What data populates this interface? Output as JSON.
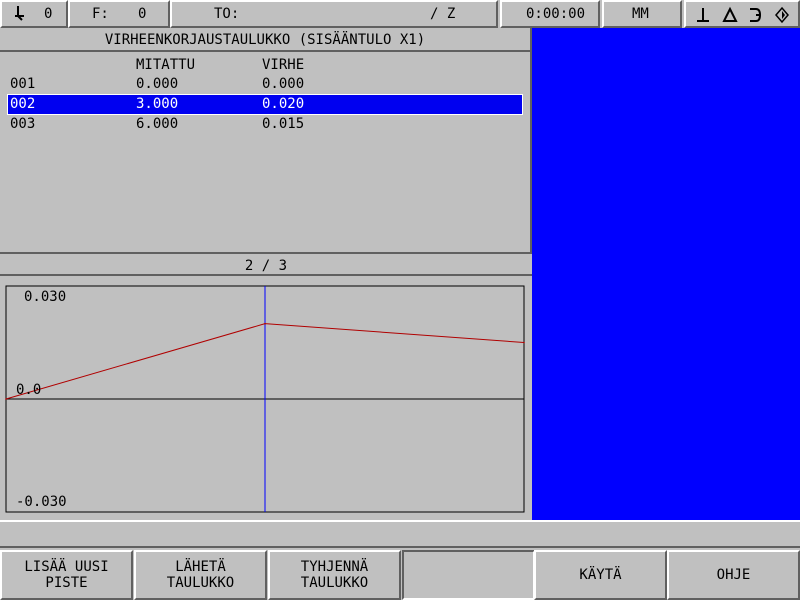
{
  "status_bar": {
    "tool_icon": "tool-icon",
    "tool_number": "0",
    "feed_label": "F:",
    "feed_value": "0",
    "tool_offset_label": "TO:",
    "axis_label": "/ Z",
    "time": "0:00:00",
    "units": "MM",
    "mode_icons": [
      "datum-icon",
      "incremental-icon",
      "reference-icon",
      "diamond-icon"
    ]
  },
  "table": {
    "title": "VIRHEENKORJAUSTAULUKKO (SISÄÄNTULO X1)",
    "columns": {
      "measured": "MITATTU",
      "error": "VIRHE"
    },
    "rows": [
      {
        "index": "001",
        "measured": "0.000",
        "error": "0.000",
        "selected": false
      },
      {
        "index": "002",
        "measured": "3.000",
        "error": "0.020",
        "selected": true
      },
      {
        "index": "003",
        "measured": "6.000",
        "error": "0.015",
        "selected": false
      }
    ]
  },
  "counter": "2 / 3",
  "chart_data": {
    "type": "line",
    "title": "",
    "xlabel": "",
    "ylabel": "",
    "ytick_labels": [
      "0.030",
      "0.0",
      "-0.030"
    ],
    "ylim": [
      -0.03,
      0.03
    ],
    "xlim": [
      0,
      6
    ],
    "x": [
      0,
      3,
      6
    ],
    "y": [
      0.0,
      0.02,
      0.015
    ],
    "cursor_x": 3,
    "line_color": "#b00000",
    "cursor_color": "#0000ff"
  },
  "softkeys": [
    {
      "label": "LISÄÄ UUSI\nPISTE"
    },
    {
      "label": "LÄHETÄ\nTAULUKKO"
    },
    {
      "label": "TYHJENNÄ\nTAULUKKO"
    },
    {
      "label": ""
    },
    {
      "label": "KÄYTÄ"
    },
    {
      "label": "OHJE"
    }
  ],
  "colors": {
    "background": "#c0c0c0",
    "highlight": "#0000f0",
    "blue_panel": "#0000ff"
  }
}
